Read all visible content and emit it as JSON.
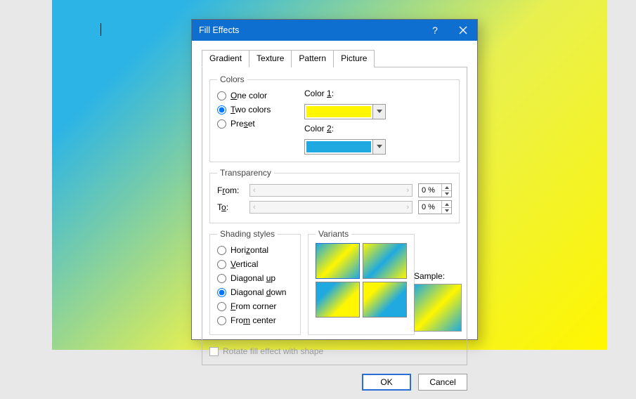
{
  "dialog": {
    "title": "Fill Effects",
    "help_glyph": "?",
    "tabs": [
      "Gradient",
      "Texture",
      "Pattern",
      "Picture"
    ],
    "active_tab": 0
  },
  "colors_group": {
    "legend": "Colors",
    "one_color": "One color",
    "two_colors": "Two colors",
    "preset": "Preset",
    "selected": "two",
    "color1_label": "Color 1:",
    "color2_label": "Color 2:",
    "color1_hex": "#fff600",
    "color2_hex": "#1fa9e0"
  },
  "transparency": {
    "legend": "Transparency",
    "from_label": "From:",
    "to_label": "To:",
    "from_value": "0 %",
    "to_value": "0 %"
  },
  "shading": {
    "legend": "Shading styles",
    "options": [
      "Horizontal",
      "Vertical",
      "Diagonal up",
      "Diagonal down",
      "From corner",
      "From center"
    ],
    "selected_index": 3
  },
  "variants": {
    "legend": "Variants"
  },
  "sample_label": "Sample:",
  "rotate_label": "Rotate fill effect with shape",
  "buttons": {
    "ok": "OK",
    "cancel": "Cancel"
  },
  "gradients": {
    "v0": "linear-gradient(135deg,#1fa9e0 0%,#fff600 50%,#1fa9e0 100%)",
    "v1": "linear-gradient(135deg,#fff600 0%,#1fa9e0 50%,#fff600 100%)",
    "v2": "linear-gradient(135deg,#1fa9e0 0%,#1fa9e0 25%,#fff600 65%,#fff600 100%)",
    "v3": "linear-gradient(135deg,#fff600 0%,#fff600 25%,#1fa9e0 65%,#1fa9e0 100%)",
    "sample": "linear-gradient(135deg,#1fa9e0 0%,#fff600 50%,#1fa9e0 100%)"
  }
}
